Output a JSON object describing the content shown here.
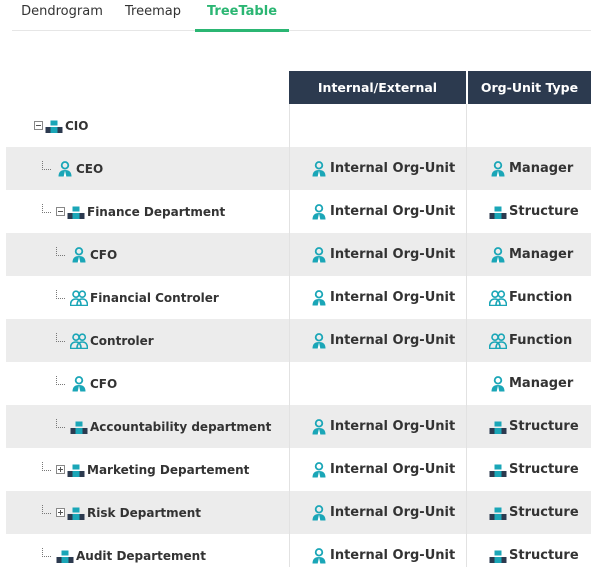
{
  "tabs": [
    {
      "label": "Dendrogram",
      "active": false
    },
    {
      "label": "Treemap",
      "active": false
    },
    {
      "label": "TreeTable",
      "active": true
    }
  ],
  "columns": {
    "internal_external": "Internal/External",
    "org_unit_type": "Org-Unit Type"
  },
  "colors": {
    "accent": "#2bb673",
    "header_bg": "#2c3a4f",
    "icon_teal": "#1aa6b7",
    "row_alt": "#ececec"
  },
  "rows": [
    {
      "label": "CIO",
      "icon": "structure-icon",
      "toggle": "collapse",
      "internal_external": "",
      "org_unit_type": "",
      "type_icon": ""
    },
    {
      "label": "CEO",
      "icon": "manager-icon",
      "toggle": "",
      "internal_external": "Internal Org-Unit",
      "org_unit_type": "Manager",
      "type_icon": "manager-icon"
    },
    {
      "label": "Finance Department",
      "icon": "structure-icon",
      "toggle": "collapse",
      "internal_external": "Internal Org-Unit",
      "org_unit_type": "Structure",
      "type_icon": "structure-icon"
    },
    {
      "label": "CFO",
      "icon": "manager-icon",
      "toggle": "",
      "internal_external": "Internal Org-Unit",
      "org_unit_type": "Manager",
      "type_icon": "manager-icon"
    },
    {
      "label": "Financial Controler",
      "icon": "function-icon",
      "toggle": "",
      "internal_external": "Internal Org-Unit",
      "org_unit_type": "Function",
      "type_icon": "function-icon"
    },
    {
      "label": "Controler",
      "icon": "function-icon",
      "toggle": "",
      "internal_external": "Internal Org-Unit",
      "org_unit_type": "Function",
      "type_icon": "function-icon"
    },
    {
      "label": "CFO",
      "icon": "manager-icon",
      "toggle": "",
      "internal_external": "",
      "org_unit_type": "Manager",
      "type_icon": "manager-icon"
    },
    {
      "label": "Accountability department",
      "icon": "structure-icon",
      "toggle": "",
      "internal_external": "Internal Org-Unit",
      "org_unit_type": "Structure",
      "type_icon": "structure-icon"
    },
    {
      "label": "Marketing Departement",
      "icon": "structure-icon",
      "toggle": "expand",
      "internal_external": "Internal Org-Unit",
      "org_unit_type": "Structure",
      "type_icon": "structure-icon"
    },
    {
      "label": "Risk Department",
      "icon": "structure-icon",
      "toggle": "expand",
      "internal_external": "Internal Org-Unit",
      "org_unit_type": "Structure",
      "type_icon": "structure-icon"
    },
    {
      "label": "Audit Departement",
      "icon": "structure-icon",
      "toggle": "",
      "internal_external": "Internal Org-Unit",
      "org_unit_type": "Structure",
      "type_icon": "structure-icon"
    }
  ]
}
